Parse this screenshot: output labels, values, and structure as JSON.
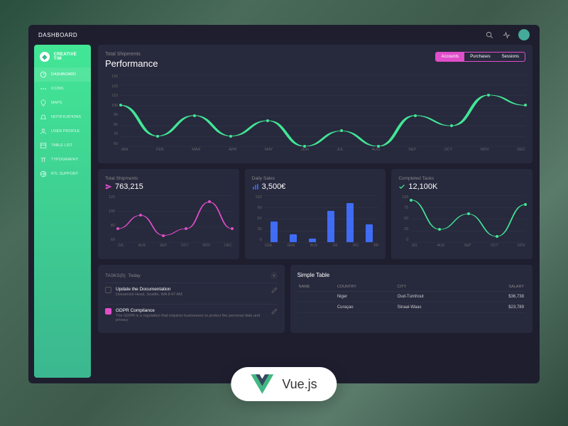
{
  "topbar": {
    "title": "DASHBOARD"
  },
  "sidebar": {
    "brand": "CREATIVE TIM",
    "items": [
      {
        "label": "DASHBOARD",
        "icon": "dashboard"
      },
      {
        "label": "ICONS",
        "icon": "icons"
      },
      {
        "label": "MAPS",
        "icon": "maps"
      },
      {
        "label": "NOTIFICATIONS",
        "icon": "bell"
      },
      {
        "label": "USER PROFILE",
        "icon": "user"
      },
      {
        "label": "TABLE LIST",
        "icon": "table"
      },
      {
        "label": "TYPOGRAPHY",
        "icon": "typo"
      },
      {
        "label": "RTL SUPPORT",
        "icon": "rtl"
      }
    ]
  },
  "hero": {
    "subtitle": "Total Shipments",
    "title": "Performance",
    "pills": [
      "Accounts",
      "Purchases",
      "Sessions"
    ],
    "active_pill": 0
  },
  "stat1": {
    "label": "Total Shipments",
    "value": "763,215",
    "color": "#e14eca"
  },
  "stat2": {
    "label": "Daily Sales",
    "value": "3,500€",
    "color": "#3f6cf5"
  },
  "stat3": {
    "label": "Completed Tasks",
    "value": "12,100K",
    "color": "#42e695"
  },
  "tasks": {
    "header": "TASKS(5)",
    "today": "Today",
    "items": [
      {
        "title": "Update the Documentation",
        "sub": "Dwuamish Head, Seattle, WA 8:47 AM",
        "checked": false
      },
      {
        "title": "GDPR Compliance",
        "sub": "The GDPR is a regulation that requires businesses to protect the personal data and privacy",
        "checked": true
      }
    ]
  },
  "table": {
    "title": "Simple Table",
    "headers": [
      "NAME",
      "COUNTRY",
      "CITY",
      "SALARY"
    ],
    "rows": [
      [
        "",
        "Niger",
        "Oud-Turnhout",
        "$36,738"
      ],
      [
        "",
        "Curaçao",
        "Sinaai-Waas",
        "$23,789"
      ]
    ]
  },
  "badge": {
    "text": "Vue.js"
  },
  "chart_data": [
    {
      "type": "line",
      "title": "Performance",
      "series_name": "Accounts",
      "color": "#42e695",
      "categories": [
        "JAN",
        "FEB",
        "MAR",
        "APR",
        "MAY",
        "JUN",
        "JUL",
        "AUG",
        "SEP",
        "OCT",
        "NOV",
        "DEC"
      ],
      "values": [
        100,
        70,
        90,
        70,
        85,
        60,
        75,
        60,
        90,
        80,
        110,
        100
      ],
      "ylim": [
        60,
        130
      ],
      "yticks": [
        60,
        70,
        80,
        90,
        100,
        110,
        120,
        130
      ]
    },
    {
      "type": "line",
      "title": "Total Shipments",
      "color": "#e14eca",
      "categories": [
        "JUL",
        "AUS",
        "SEP",
        "OCT",
        "NOV",
        "DEC"
      ],
      "values": [
        80,
        100,
        70,
        80,
        120,
        80
      ],
      "ylim": [
        60,
        130
      ],
      "yticks": [
        60,
        80,
        100,
        120
      ]
    },
    {
      "type": "bar",
      "title": "Daily Sales",
      "color": "#3f6cf5",
      "categories": [
        "USA",
        "GER",
        "AUS",
        "UK",
        "RO",
        "BR"
      ],
      "values": [
        53,
        20,
        10,
        80,
        100,
        45
      ],
      "ylim": [
        0,
        120
      ],
      "yticks": [
        0,
        30,
        60,
        90,
        120
      ]
    },
    {
      "type": "line",
      "title": "Completed Tasks",
      "color": "#42e695",
      "categories": [
        "JUL",
        "AUS",
        "SEP",
        "OCT",
        "NOV"
      ],
      "values": [
        90,
        27,
        60,
        12,
        80
      ],
      "ylim": [
        0,
        100
      ],
      "yticks": [
        0,
        25,
        50,
        75,
        100
      ]
    }
  ]
}
